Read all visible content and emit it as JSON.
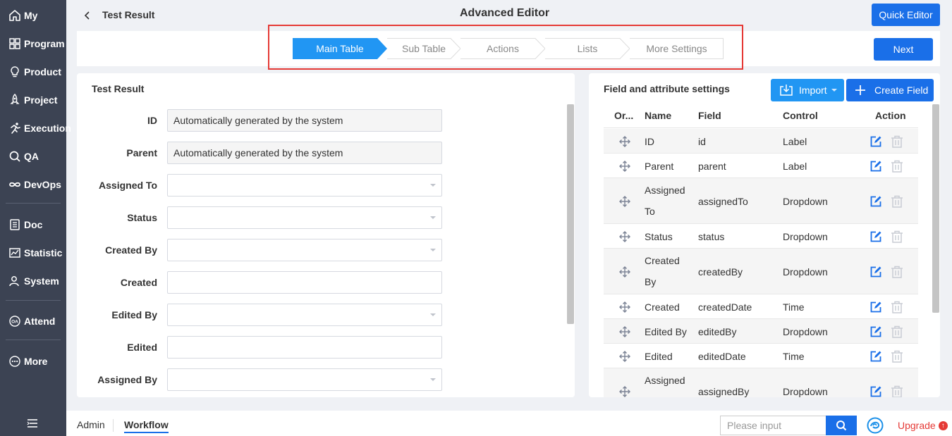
{
  "sidebar": {
    "items": [
      {
        "label": "My",
        "icon": "home-icon"
      },
      {
        "label": "Program",
        "icon": "grid-icon"
      },
      {
        "label": "Product",
        "icon": "lightbulb-icon"
      },
      {
        "label": "Project",
        "icon": "rocket-icon"
      },
      {
        "label": "Execution",
        "icon": "runner-icon"
      },
      {
        "label": "QA",
        "icon": "magnifier-icon"
      },
      {
        "label": "DevOps",
        "icon": "infinity-icon"
      },
      {
        "label": "Doc",
        "icon": "document-icon"
      },
      {
        "label": "Statistic",
        "icon": "chart-icon"
      },
      {
        "label": "System",
        "icon": "users-icon"
      },
      {
        "label": "Attend",
        "icon": "oa-icon"
      },
      {
        "label": "More",
        "icon": "more-icon"
      }
    ]
  },
  "header": {
    "back_title": "Test Result",
    "page_title": "Advanced Editor",
    "quick_editor_label": "Quick Editor"
  },
  "steps": {
    "items": [
      "Main Table",
      "Sub Table",
      "Actions",
      "Lists",
      "More Settings"
    ],
    "active": "Main Table",
    "next_label": "Next",
    "accent": "#2196f3"
  },
  "form": {
    "title": "Test Result",
    "fields": [
      {
        "label": "ID",
        "value": "Automatically generated by the system",
        "type": "readonly"
      },
      {
        "label": "Parent",
        "value": "Automatically generated by the system",
        "type": "readonly"
      },
      {
        "label": "Assigned To",
        "value": "",
        "type": "select"
      },
      {
        "label": "Status",
        "value": "",
        "type": "select"
      },
      {
        "label": "Created By",
        "value": "",
        "type": "select"
      },
      {
        "label": "Created",
        "value": "",
        "type": "text"
      },
      {
        "label": "Edited By",
        "value": "",
        "type": "select"
      },
      {
        "label": "Edited",
        "value": "",
        "type": "text"
      },
      {
        "label": "Assigned By",
        "value": "",
        "type": "select"
      }
    ]
  },
  "field_settings": {
    "title": "Field and attribute settings",
    "import_label": "Import",
    "create_label": "Create Field",
    "columns": [
      "Or...",
      "Name",
      "Field",
      "Control",
      "Action"
    ],
    "rows": [
      {
        "name": "ID",
        "field": "id",
        "control": "Label"
      },
      {
        "name": "Parent",
        "field": "parent",
        "control": "Label"
      },
      {
        "name": "Assigned To",
        "name_lines": [
          "Assigned",
          "To"
        ],
        "field": "assignedTo",
        "control": "Dropdown"
      },
      {
        "name": "Status",
        "field": "status",
        "control": "Dropdown"
      },
      {
        "name": "Created By",
        "name_lines": [
          "Created",
          "By"
        ],
        "field": "createdBy",
        "control": "Dropdown"
      },
      {
        "name": "Created",
        "field": "createdDate",
        "control": "Time"
      },
      {
        "name": "Edited By",
        "field": "editedBy",
        "control": "Dropdown"
      },
      {
        "name": "Edited",
        "field": "editedDate",
        "control": "Time"
      },
      {
        "name": "Assigned",
        "name_lines": [
          "Assigned",
          ""
        ],
        "field": "assignedBy",
        "control": "Dropdown"
      }
    ]
  },
  "footer": {
    "tabs": [
      "Admin",
      "Workflow"
    ],
    "active_tab": "Workflow",
    "search_placeholder": "Please input",
    "upgrade_label": "Upgrade"
  }
}
